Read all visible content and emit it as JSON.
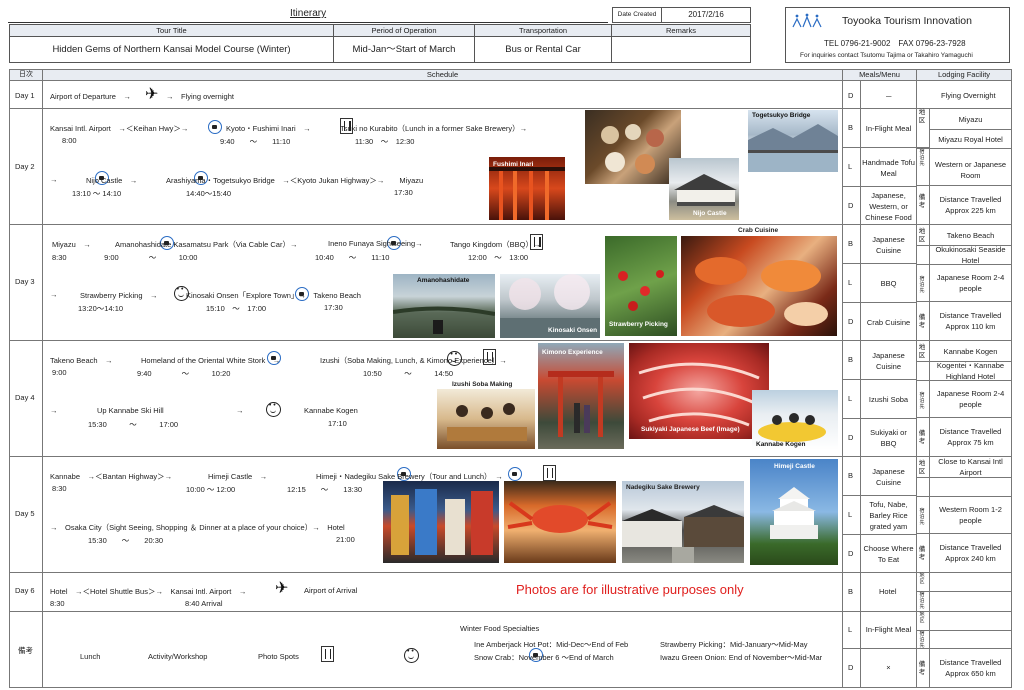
{
  "header": {
    "itinerary": "Itinerary",
    "date_created_label": "Date Created",
    "date_created_value": "2017/2/16",
    "tour_title_label": "Tour Title",
    "tour_title_value": "Hidden Gems of Northern Kansai Model Course (Winter)",
    "period_label": "Period of Operation",
    "period_value": "Mid-Jan～Start of March",
    "transport_label": "Transportation",
    "transport_value": "Bus or Rental Car",
    "remarks_label": "Remarks",
    "company_name": "Toyooka Tourism Innovation",
    "tel_fax": "TEL 0796-21-9002　FAX 0796-23-7928",
    "inquiries": "For inquiries contact Tsutomu Tajima or Takahiro Yamaguchi"
  },
  "columns": {
    "day": "日次",
    "schedule": "Schedule",
    "meals": "Meals/Menu",
    "lodging": "Lodging Facility"
  },
  "day1": {
    "label": "Day 1",
    "depart": "Airport of Departure　→",
    "overnight": "Flying overnight",
    "meal_code": "D",
    "meal": "－",
    "lodging": "Flying Overnight"
  },
  "day2": {
    "label": "Day 2",
    "l1a": "Kansai Intl. Airport　→＜Keihan Hwy＞→",
    "l1b": "Kyoto・Fushimi Inari　→",
    "l1c": "Tsuki no Kurabito（Lunch in a former Sake Brewery）→",
    "t1a": "8:00",
    "t1b": "9:40　　～　　11:10",
    "t1c": "11:30　～　12:30",
    "l2a": "→",
    "l2b": "Nijo Castle　→",
    "l2c": "Arashiyama・Togetsukyo Bridge　→＜Kyoto Jukan Highway＞→　　Miyazu",
    "t2a": "13:10 ～ 14:10",
    "t2b": "14:40～15:40",
    "t2c": "17:30",
    "photos": [
      "Fushimi Inari",
      "Nijo Castle",
      "Togetsukyo Bridge"
    ],
    "meals": [
      {
        "code": "B",
        "text": "In-Flight Meal"
      },
      {
        "code": "L",
        "text": "Handmade Tofu Meal"
      },
      {
        "code": "D",
        "text": "Japanese, Western, or Chinese Food"
      }
    ],
    "lodging_area_tag": "地区",
    "lodging_area": "Miyazu",
    "lodging_hotel": "Miyazu Royal Hotel",
    "lodging_room": "Western or Japanese Room",
    "lodging_tag": "備考",
    "lodging_note": "Distance Travelled Approx 225 km"
  },
  "day3": {
    "label": "Day 3",
    "l1a": "Miyazu　→",
    "l1b": "Amanohashidate Kasamatsu Park（Via Cable Car）→",
    "l1c": "Ineno Funaya Sightseeing→",
    "l1d": "Tango Kingdom（BBQ）→",
    "t1": "8:30　　　　　9:00　　　　～　　　10:00",
    "t1b": "10:40　　～　　11:10",
    "t1c": "12:00　～　13:00",
    "l2a": "→",
    "l2b": "Strawberry Picking　→",
    "l2c": "Kinosaki Onsen「Explore Town」→　Takeno Beach",
    "t2a": "13:20～14:10",
    "t2b": "15:10　～　17:00",
    "t2c": "17:30",
    "photos": [
      "Amanohashidate",
      "Kinosaki Onsen",
      "Strawberry Picking",
      "Crab Cuisine"
    ],
    "meals": [
      {
        "code": "B",
        "text": "Japanese Cuisine"
      },
      {
        "code": "L",
        "text": "BBQ"
      },
      {
        "code": "D",
        "text": "Crab Cuisine"
      }
    ],
    "lodging_area": "Takeno Beach",
    "lodging_hotel": "Okukinosaki Seaside Hotel",
    "lodging_room": "Japanese Room 2-4 people",
    "lodging_note": "Distance Travelled Approx 110 km"
  },
  "day4": {
    "label": "Day 4",
    "l1a": "Takeno Beach　→",
    "l1b": "Homeland of the Oriental White Stork　→",
    "l1c": "Izushi（Soba Making, Lunch, & Kimono Experience）→",
    "t1a": "9:00",
    "t1b": "9:40　　　　～　　　10:20",
    "t1c": "10:50　　　～　　　14:50",
    "l2a": "→",
    "l2b": "Up Kannabe Ski Hill",
    "l2c": "→",
    "l2d": "Kannabe Kogen",
    "t2a": "15:30　　　～　　　17:00",
    "t2b": "17:10",
    "photos": [
      "Izushi Soba Making",
      "Kimono Experience",
      "Sukiyaki Japanese Beef (Image)",
      "Kannabe Kogen"
    ],
    "meals": [
      {
        "code": "B",
        "text": "Japanese Cuisine"
      },
      {
        "code": "L",
        "text": "Izushi Soba"
      },
      {
        "code": "D",
        "text": "Sukiyaki or BBQ"
      }
    ],
    "lodging_area": "Kannabe Kogen",
    "lodging_hotel": "Kogentei・Kannabe Highland Hotel",
    "lodging_room": "Japanese Room 2-4 people",
    "lodging_note": "Distance Travelled Approx 75 km"
  },
  "day5": {
    "label": "Day 5",
    "l1a": "Kannabe　→＜Bantan Highway＞→",
    "l1b": "Himeji Castle　→",
    "l1c": "Himeji・Nadegiku Sake Brewery（Tour and Lunch）　→",
    "t1a": "8:30",
    "t1b": "10:00 ～ 12:00",
    "t1c": "12:15　　～　　13:30",
    "l2": "→　Osaka City（Sight Seeing, Shopping ＆ Dinner at a place of your choice）→　Hotel",
    "t2a": "15:30　　～　　20:30",
    "t2b": "21:00",
    "photos": [
      "Nadegiku Sake Brewery",
      "Himeji Castle"
    ],
    "meals": [
      {
        "code": "B",
        "text": "Japanese Cuisine"
      },
      {
        "code": "L",
        "text": "Tofu, Nabe, Barley Rice grated yam"
      },
      {
        "code": "D",
        "text": "Choose Where To Eat"
      }
    ],
    "lodging_area": "Close to Kansai Intl Airport",
    "lodging_room": "Western Room 1-2 people",
    "lodging_note": "Distance Travelled Approx 240 km"
  },
  "day6": {
    "label": "Day 6",
    "l1a": "Hotel　→＜Hotel Shuttle Bus＞→　Kansai Intl. Airport　→",
    "l1b": "Airport of Arrival",
    "t1a": "8:30",
    "t1b": "8:40 Arrival",
    "disclaimer": "Photos are for illustrative purposes only",
    "meal_code": "B",
    "meal": "Hotel"
  },
  "notes": {
    "label": "備考",
    "legend_lunch": "Lunch",
    "legend_activity": "Activity/Workshop",
    "legend_photo": "Photo Spots",
    "food_title": "Winter Food Specialties",
    "food1": "Ine Amberjack Hot Pot：Mid-Dec～End of Feb",
    "food2": "Snow Crab：November 6 ～End of March",
    "food3": "Strawberry Picking：Mid-January～Mid-May",
    "food4": "Iwazu Green Onion: End of November～Mid-Mar",
    "meals": [
      {
        "code": "L",
        "text": "In-Flight Meal"
      },
      {
        "code": "D",
        "text": "×"
      }
    ],
    "lodging_note": "Distance Travelled Approx 650 km"
  },
  "colors": {
    "accent_blue": "#2a6cc4",
    "disclaimer_red": "#e0201e",
    "header_gray": "#e8ecf2"
  }
}
